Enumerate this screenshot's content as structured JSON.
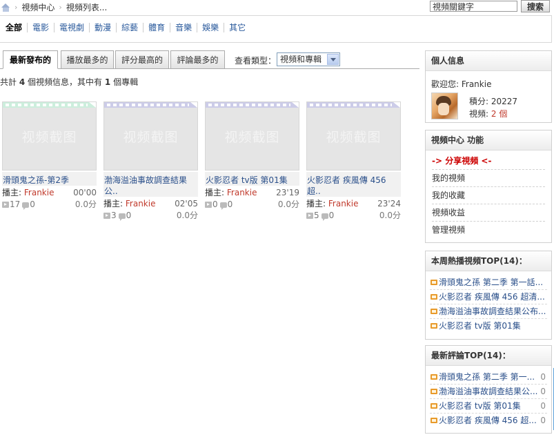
{
  "breadcrumb": {
    "items": [
      "視頻中心",
      "視頻列表..."
    ]
  },
  "search": {
    "value": "視頻關鍵字",
    "button": "搜索"
  },
  "categories": [
    "全部",
    "電影",
    "電視劇",
    "動漫",
    "綜藝",
    "體育",
    "音樂",
    "娛樂",
    "其它"
  ],
  "tabs": [
    "最新發布的",
    "播放最多的",
    "評分最高的",
    "評論最多的"
  ],
  "type_filter": {
    "label": "查看類型：",
    "selected": "視頻和專輯"
  },
  "summary": {
    "prefix": "共計",
    "video_count": "4",
    "mid": "個視頻信息，其中有",
    "album_count": "1",
    "suffix": "個專輯"
  },
  "thumb_placeholder": "视频截图",
  "uploader_label": "播主:",
  "videos": [
    {
      "title": "滑頭鬼之孫-第2季",
      "title2": "",
      "uploader": "Frankie",
      "duration": "00'00",
      "plays": "17",
      "comments": "0",
      "score": "0.0分"
    },
    {
      "title": "渤海溢油事故調查結果",
      "title2": "公..",
      "uploader": "Frankie",
      "duration": "02'05",
      "plays": "3",
      "comments": "0",
      "score": "0.0分"
    },
    {
      "title": "火影忍者 tv版 第01集",
      "title2": "",
      "uploader": "Frankie",
      "duration": "23'19",
      "plays": "0",
      "comments": "0",
      "score": "0.0分"
    },
    {
      "title": "火影忍者 疾風傳 456",
      "title2": "超..",
      "uploader": "Frankie",
      "duration": "23'24",
      "plays": "5",
      "comments": "0",
      "score": "0.0分"
    }
  ],
  "profile": {
    "heading": "個人信息",
    "welcome": "歡迎您: Frankie",
    "points_label": "積分:",
    "points": "20227",
    "videos_label": "視頻:",
    "videos": "2 個"
  },
  "functions": {
    "heading": "視頻中心 功能",
    "items": [
      "-> 分享視頻 <-",
      "我的視頻",
      "我的收藏",
      "視頻收益",
      "管理視頻"
    ]
  },
  "hot_week": {
    "heading": "本周熱播視頻TOP(14)：",
    "items": [
      "滑頭鬼之孫 第二季 第一話...",
      "火影忍者 疾風傳 456 超清...",
      "渤海溢油事故調查結果公布...",
      "火影忍者 tv版 第01集"
    ]
  },
  "latest_comments": {
    "heading": "最新評論TOP(14)：",
    "items": [
      {
        "title": "滑頭鬼之孫 第二季 第一...",
        "count": "0"
      },
      {
        "title": "渤海溢油事故調查結果公...",
        "count": "0"
      },
      {
        "title": "火影忍者 tv版 第01集",
        "count": "0"
      },
      {
        "title": "火影忍者 疾風傳 456 超...",
        "count": "0"
      }
    ]
  }
}
